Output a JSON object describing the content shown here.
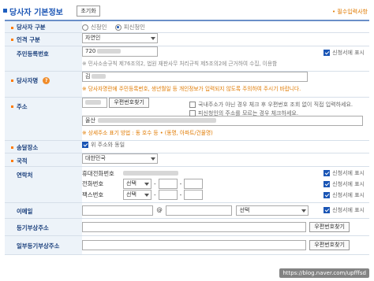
{
  "header": {
    "title": "당사자 기본정보",
    "reset_label": "초기화",
    "required_note": "• 필수입력사항"
  },
  "party_type": {
    "label": "당사자 구분",
    "options": [
      "신청인",
      "피신청인"
    ],
    "selected": "피신청인"
  },
  "person_type": {
    "label": "인격 구분",
    "value": "자연인"
  },
  "id_number": {
    "label": "주민등록번호",
    "prefix": "720",
    "note": "※ 민사소송규칙 제76조의2, 법원 재판사무 처리규칙 제5조의2에 근거하여 수집, 이용함",
    "display_label": "신청서에 표시"
  },
  "name": {
    "label": "당사자명",
    "value_prefix": "김",
    "note": "※ 당사자명란에 주민등록번호, 생년월일 등 개인정보가 입력되지 않도록 주의하여 주시기 바랍니다."
  },
  "address": {
    "label": "주소",
    "postcode_button": "우편번호찾기",
    "check_foreign": "국내주소가 아닌 경우 체크 후 우편번호 조회 없이 직접 입력하세요.",
    "check_unknown": "피신청인의 주소를 모르는 경우 체크하세요.",
    "line_prefix": "울산",
    "example_note": "※ 상세주소 표기 방법 : 동 호수 등 • (동명, 아파트/건물명)"
  },
  "delivery": {
    "label": "송달장소",
    "check_label": "위 주소와 동일"
  },
  "nationality": {
    "label": "국적",
    "value": "대한민국"
  },
  "contact": {
    "label": "연락처",
    "mobile_label": "휴대전화번호",
    "phone_label": "전화번호",
    "fax_label": "팩스번호",
    "select_placeholder": "선택",
    "dash": "-",
    "display_label": "신청서에 표시"
  },
  "email": {
    "label": "이메일",
    "at": "@",
    "select_placeholder": "선택",
    "display_label": "신청서에 표시"
  },
  "registry_address": {
    "label": "등기부상주소",
    "postcode_button": "우편번호찾기"
  },
  "partial_registry_address": {
    "label": "일부등기부상주소",
    "postcode_button": "우편번호찾기"
  },
  "watermark": "https://blog.naver.com/upfffsd"
}
